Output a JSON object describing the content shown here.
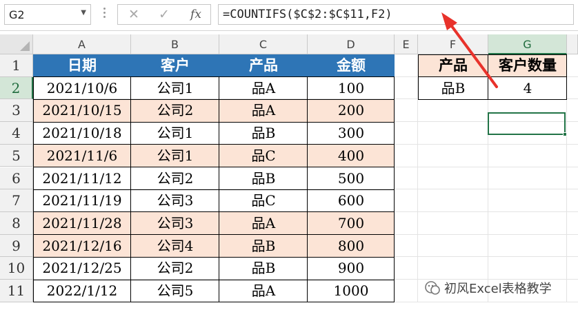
{
  "name_box": "G2",
  "formula_bar": {
    "cancel_icon": "x-icon",
    "enter_icon": "checkmark-icon",
    "fx_label": "fx",
    "formula": "=COUNTIFS($C$2:$C$11,F2)"
  },
  "columns": [
    "A",
    "B",
    "C",
    "D",
    "E",
    "F",
    "G"
  ],
  "rows": [
    "1",
    "2",
    "3",
    "4",
    "5",
    "6",
    "7",
    "8",
    "9",
    "10",
    "11"
  ],
  "table": {
    "headers": [
      "日期",
      "客户",
      "产品",
      "金额"
    ],
    "rows": [
      [
        "2021/10/6",
        "公司1",
        "品A",
        "100"
      ],
      [
        "2021/10/15",
        "公司2",
        "品A",
        "200"
      ],
      [
        "2021/10/18",
        "公司1",
        "品B",
        "300"
      ],
      [
        "2021/11/6",
        "公司1",
        "品C",
        "400"
      ],
      [
        "2021/11/12",
        "公司2",
        "品B",
        "500"
      ],
      [
        "2021/11/19",
        "公司3",
        "品C",
        "600"
      ],
      [
        "2021/11/28",
        "公司3",
        "品A",
        "700"
      ],
      [
        "2021/12/16",
        "公司4",
        "品B",
        "800"
      ],
      [
        "2021/12/25",
        "公司2",
        "品B",
        "900"
      ],
      [
        "2022/1/12",
        "公司5",
        "品A",
        "1000"
      ]
    ],
    "highlight_rows": [
      2,
      4,
      7,
      8
    ]
  },
  "lookup": {
    "headers": [
      "产品",
      "客户数量"
    ],
    "values": [
      "品B",
      "4"
    ]
  },
  "selected_cell": "G2",
  "colors": {
    "header_fill": "#2e75b6",
    "band_fill": "#fce4d6",
    "selection": "#217346",
    "arrow": "#e8322b"
  },
  "watermark": "初风Excel表格教学"
}
